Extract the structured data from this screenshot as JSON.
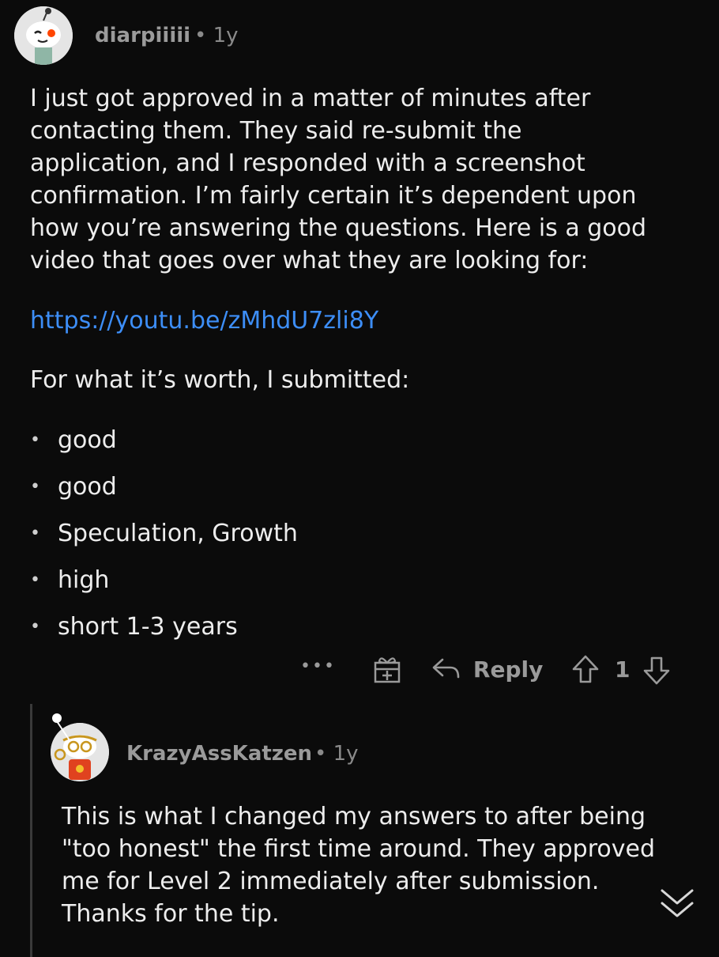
{
  "comment": {
    "username": "diarpiiiii",
    "age": "• 1y",
    "body": "I just got approved in a matter of minutes after\ncontacting them. They said re-submit the\napplication, and I responded with a screenshot\nconfirmation. I’m fairly certain it’s dependent upon\nhow you’re answering the questions. Here is a good\nvideo that goes over what they are looking for:",
    "link": "https://youtu.be/zMhdU7zli8Y",
    "worth": "For what it’s worth, I submitted:",
    "bullets": [
      "good",
      "good",
      "Speculation, Growth",
      "high",
      "short 1-3 years"
    ],
    "actions": {
      "more": "•••",
      "reply_label": "Reply",
      "score": "1"
    }
  },
  "reply": {
    "username": "KrazyAssKatzen",
    "age": "• 1y",
    "body": "This is what I changed my answers to after being\n\"too honest\" the first time around. They approved\nme for Level 2 immediately after submission.\nThanks for the tip."
  },
  "colors": {
    "background": "#0b0b0b",
    "link": "#3d8ef7",
    "muted": "#9a9a9a"
  },
  "icons": [
    "avatar-snoo",
    "more-icon",
    "award-icon",
    "reply-icon",
    "upvote-icon",
    "downvote-icon",
    "chevron-down-icon"
  ]
}
